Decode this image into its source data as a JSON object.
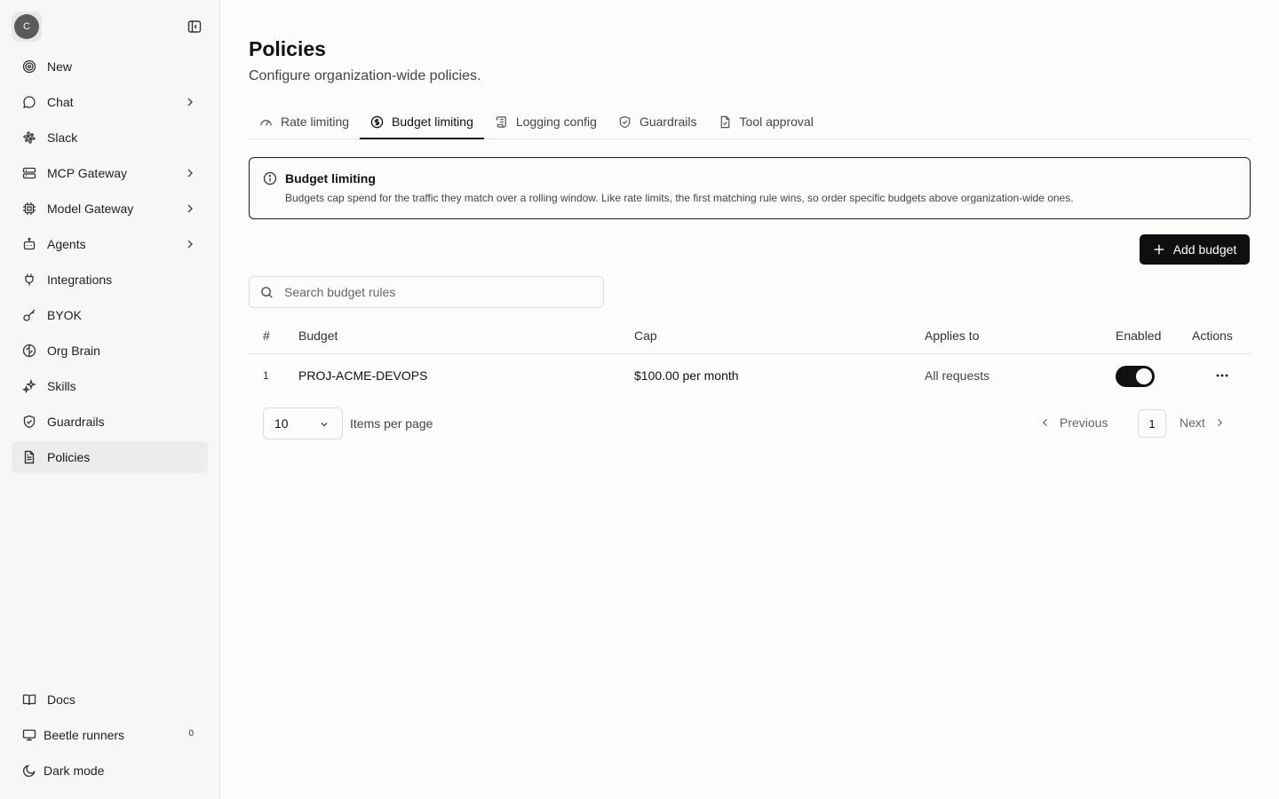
{
  "sidebar": {
    "avatar_initial": "C",
    "items": [
      {
        "label": "New",
        "icon": "target-icon",
        "has_chevron": false
      },
      {
        "label": "Chat",
        "icon": "chat-bubble-icon",
        "has_chevron": true
      },
      {
        "label": "Slack",
        "icon": "slack-icon",
        "has_chevron": false
      },
      {
        "label": "MCP Gateway",
        "icon": "server-icon",
        "has_chevron": true
      },
      {
        "label": "Model Gateway",
        "icon": "cpu-icon",
        "has_chevron": true
      },
      {
        "label": "Agents",
        "icon": "bot-icon",
        "has_chevron": true
      },
      {
        "label": "Integrations",
        "icon": "plug-icon",
        "has_chevron": false
      },
      {
        "label": "BYOK",
        "icon": "key-icon",
        "has_chevron": false
      },
      {
        "label": "Org Brain",
        "icon": "brain-icon",
        "has_chevron": false
      },
      {
        "label": "Skills",
        "icon": "sparkles-icon",
        "has_chevron": false
      },
      {
        "label": "Guardrails",
        "icon": "shield-icon",
        "has_chevron": false
      },
      {
        "label": "Policies",
        "icon": "document-icon",
        "has_chevron": false,
        "active": true
      }
    ],
    "bottom": {
      "docs": "Docs",
      "runners": "Beetle runners",
      "runners_count": "0",
      "dark_mode": "Dark mode"
    }
  },
  "page": {
    "title": "Policies",
    "subtitle": "Configure organization-wide policies."
  },
  "tabs": [
    {
      "label": "Rate limiting",
      "icon": "gauge-icon"
    },
    {
      "label": "Budget limiting",
      "icon": "dollar-circle-icon",
      "active": true
    },
    {
      "label": "Logging config",
      "icon": "scroll-icon"
    },
    {
      "label": "Guardrails",
      "icon": "shield-check-icon"
    },
    {
      "label": "Tool approval",
      "icon": "file-check-icon"
    }
  ],
  "alert": {
    "title": "Budget limiting",
    "body": "Budgets cap spend for the traffic they match over a rolling window. Like rate limits, the first matching rule wins, so order specific budgets above organization-wide ones."
  },
  "toolbar": {
    "add_label": "Add budget",
    "search_placeholder": "Search budget rules"
  },
  "table": {
    "headers": {
      "num": "#",
      "budget": "Budget",
      "cap": "Cap",
      "applies": "Applies to",
      "enabled": "Enabled",
      "actions": "Actions"
    },
    "rows": [
      {
        "num": "1",
        "budget": "PROJ-ACME-DEVOPS",
        "cap": "$100.00 per month",
        "applies": "All requests",
        "enabled": true
      }
    ]
  },
  "pagination": {
    "per_page": "10",
    "per_page_label": "Items per page",
    "previous": "Previous",
    "current_page": "1",
    "next": "Next"
  }
}
